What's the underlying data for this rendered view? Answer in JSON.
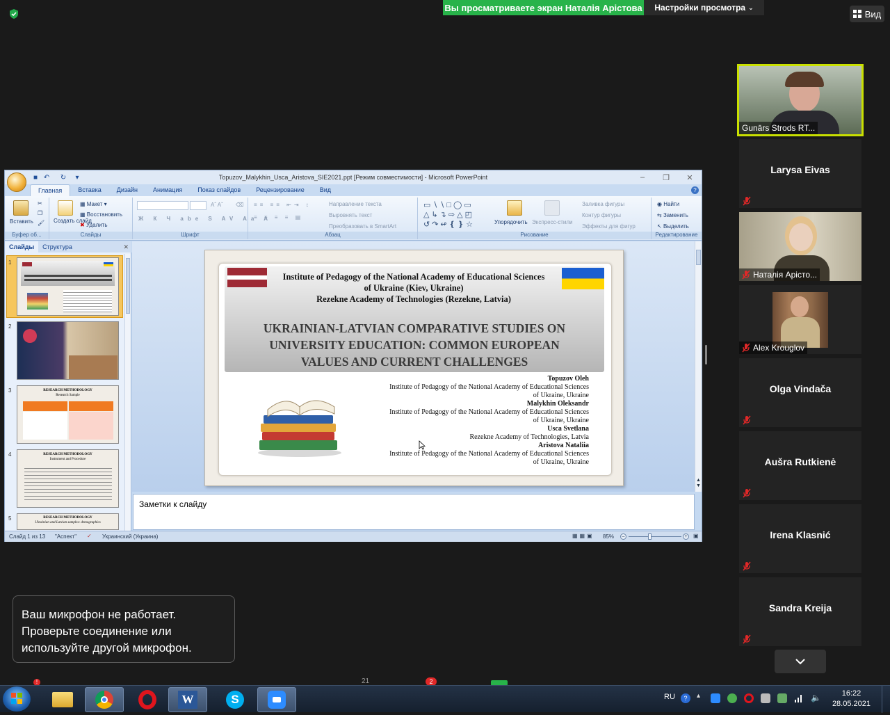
{
  "zoom": {
    "share_banner": "Вы просматриваете экран Наталія Арістова",
    "view_options": "Настройки просмотра",
    "view_button": "Вид",
    "toast": [
      "Ваш микрофон не работает.",
      "Проверьте соединение или",
      "используйте другой микрофон."
    ]
  },
  "ppt": {
    "window_title": "Topuzov_Malykhin_Usca_Aristova_SIE2021.ppt [Режим совместимости] - Microsoft PowerPoint",
    "tabs": [
      "Главная",
      "Вставка",
      "Дизайн",
      "Анимация",
      "Показ слайдов",
      "Рецензирование",
      "Вид"
    ],
    "ribbon": {
      "paste": "Вставить",
      "clipboard": "Буфер об...",
      "layout": "Макет",
      "reset": "Восстановить",
      "new_slide": "Создать слайд",
      "delete": "Удалить",
      "slides": "Слайды",
      "font": "Шрифт",
      "text_dir": "Направление текста",
      "align_text": "Выровнять текст",
      "smartart": "Преобразовать в SmartArt",
      "paragraph": "Абзац",
      "arrange": "Упорядочить",
      "quick_styles": "Экспресс-стили",
      "shape_fill": "Заливка фигуры",
      "shape_outline": "Контур фигуры",
      "shape_effects": "Эффекты для фигур",
      "drawing": "Рисование",
      "find": "Найти",
      "replace": "Заменить",
      "select": "Выделить",
      "editing": "Редактирование"
    },
    "panel_tabs": [
      "Слайды",
      "Структура"
    ],
    "thumbs": [
      "1",
      "2",
      "3",
      "4",
      "5"
    ],
    "thumb_texts": {
      "t3_title": "RESEARCH METHODOLOGY",
      "t3_sub": "Research Sample",
      "t4_title": "RESEARCH METHODOLOGY",
      "t4_sub": "Instrument and Procedure",
      "t5_title": "RESEARCH METHODOLOGY",
      "t5_sub": "Ukrainian and Latvian samples: demographics"
    },
    "slide": {
      "inst1": "Institute of  Pedagogy of the National Academy of  Educational Sciences",
      "inst2": "of  Ukraine (Kiev, Ukraine)",
      "inst3": "Rezekne Academy of Technologies  (Rezekne, Latvia)",
      "title1": "UKRAINIAN-LATVIAN COMPARATIVE STUDIES ON",
      "title2": "UNIVERSITY EDUCATION: COMMON EUROPEAN",
      "title3": "VALUES AND CURRENT CHALLENGES",
      "authors": [
        {
          "name": "Topuzov Oleh",
          "aff1": "Institute of Pedagogy of the National Academy of Educational Sciences",
          "aff2": "of Ukraine, Ukraine"
        },
        {
          "name": "Malykhin Oleksandr",
          "aff1": "Institute of Pedagogy of the National Academy of Educational Sciences",
          "aff2": "of Ukraine, Ukraine"
        },
        {
          "name": "Usca Svetlana",
          "aff1": "Rezekne Academy of Technologies, Latvia",
          "aff2": ""
        },
        {
          "name": "Aristova Nataliia",
          "aff1": "Institute of Pedagogy of the National Academy of Educational Sciences",
          "aff2": "of Ukraine, Ukraine"
        }
      ]
    },
    "notes_placeholder": "Заметки к слайду",
    "status": {
      "slide": "Слайд 1 из 13",
      "theme": "\"Аспект\"",
      "lang": "Украинский (Украина)",
      "zoom": "85%"
    }
  },
  "participants": [
    {
      "name": "Gunārs Strods RT...",
      "video": true
    },
    {
      "name": "Larysa Eivas",
      "video": false
    },
    {
      "name": "Наталія Арісто...",
      "video": true
    },
    {
      "name": "Alex Krouglov",
      "video": true
    },
    {
      "name": "Olga Vindača",
      "video": false
    },
    {
      "name": "Aušra Rutkienė",
      "video": false
    },
    {
      "name": "Irena Klasnić",
      "video": false
    },
    {
      "name": "Sandra Kreija",
      "video": false
    }
  ],
  "taskbar": {
    "lang": "RU",
    "time": "16:22",
    "date": "28.05.2021",
    "participants_count": "21",
    "chat_badge": "2",
    "notif_badge": "!"
  },
  "colors": {
    "zoom_green": "#28b34a",
    "mic_red": "#e02828",
    "active_speaker": "#c9e000"
  }
}
